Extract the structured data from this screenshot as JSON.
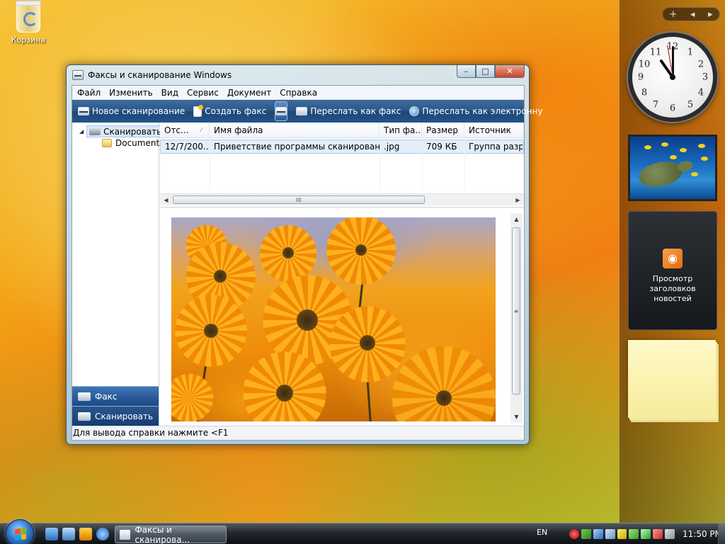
{
  "desktop": {
    "recycle_bin_label": "Корзина"
  },
  "window": {
    "title": "Факсы и сканирование Windows",
    "caption_buttons": {
      "minimize": "–",
      "maximize": "□",
      "close": "✕"
    },
    "menu": [
      "Файл",
      "Изменить",
      "Вид",
      "Сервис",
      "Документ",
      "Справка"
    ],
    "toolbar": {
      "new_scan": "Новое сканирование",
      "create_fax": "Создать факс",
      "forward_fax": "Переслать как факс",
      "forward_email": "Переслать как электронну"
    },
    "nav": {
      "root": "Сканировать",
      "child": "Documents",
      "buttons": [
        "Факс",
        "Сканировать"
      ]
    },
    "list": {
      "columns": [
        "Отс...",
        "Имя файла",
        "Тип фа...",
        "Размер",
        "Источник"
      ],
      "rows": [
        [
          "12/7/200...",
          "Приветствие программы сканирования",
          ".jpg",
          "709 КБ",
          "Группа разра"
        ]
      ],
      "scroll_grip": "III"
    },
    "preview_scroll_grip": "≡",
    "status": "Для вывода справки нажмите <F1"
  },
  "sidebar": {
    "controls": {
      "add": "+",
      "prev": "◂",
      "next": "▸"
    },
    "clock_numbers": [
      "12",
      "1",
      "2",
      "3",
      "4",
      "5",
      "6",
      "7",
      "8",
      "9",
      "10",
      "11"
    ],
    "feed_text": "Просмотр заголовков новостей",
    "feed_icon": "rss-icon"
  },
  "taskbar": {
    "active_task": "Факсы и сканирова...",
    "language": "EN",
    "time": "11:50 PM"
  },
  "colors": {
    "toolbar_blue": "#24548a",
    "nav_button_blue": "#2c5e9b",
    "selection": "#e4eefa",
    "close_red": "#c8452a"
  }
}
